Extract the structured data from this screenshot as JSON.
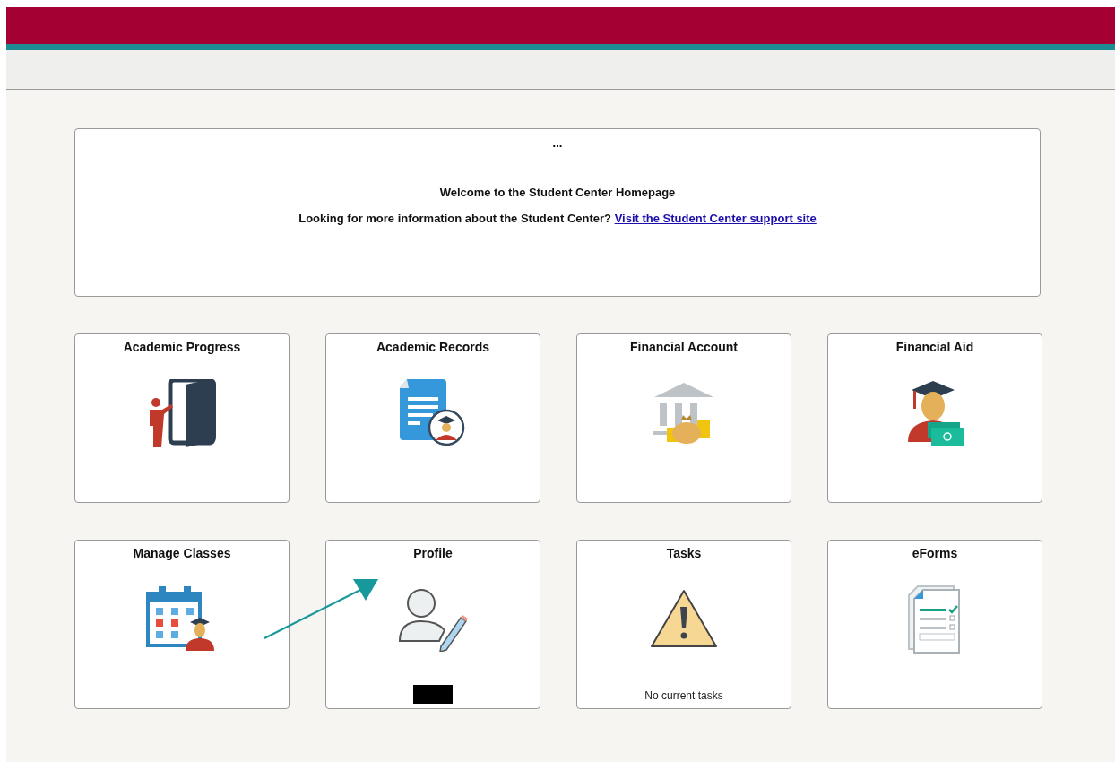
{
  "banner": {
    "ellipsis": "...",
    "title": "Welcome to the Student Center Homepage",
    "text": "Looking for more information about the Student Center?",
    "link": "Visit the Student Center support site"
  },
  "tiles": [
    {
      "title": "Academic Progress",
      "kind": "progress",
      "redacted": false
    },
    {
      "title": "Academic Records",
      "kind": "records",
      "redacted": false
    },
    {
      "title": "Financial Account",
      "kind": "account",
      "redacted": false
    },
    {
      "title": "Financial Aid",
      "kind": "aid",
      "redacted": false
    },
    {
      "title": "Manage Classes",
      "kind": "classes",
      "redacted": false
    },
    {
      "title": "Profile",
      "kind": "profile",
      "redacted": true
    },
    {
      "title": "Tasks",
      "kind": "tasks",
      "redacted": false,
      "note": "No current tasks"
    },
    {
      "title": "eForms",
      "kind": "eforms",
      "redacted": false
    }
  ],
  "annotations": [
    {
      "kind": "arrow",
      "color": "#17989a"
    }
  ]
}
